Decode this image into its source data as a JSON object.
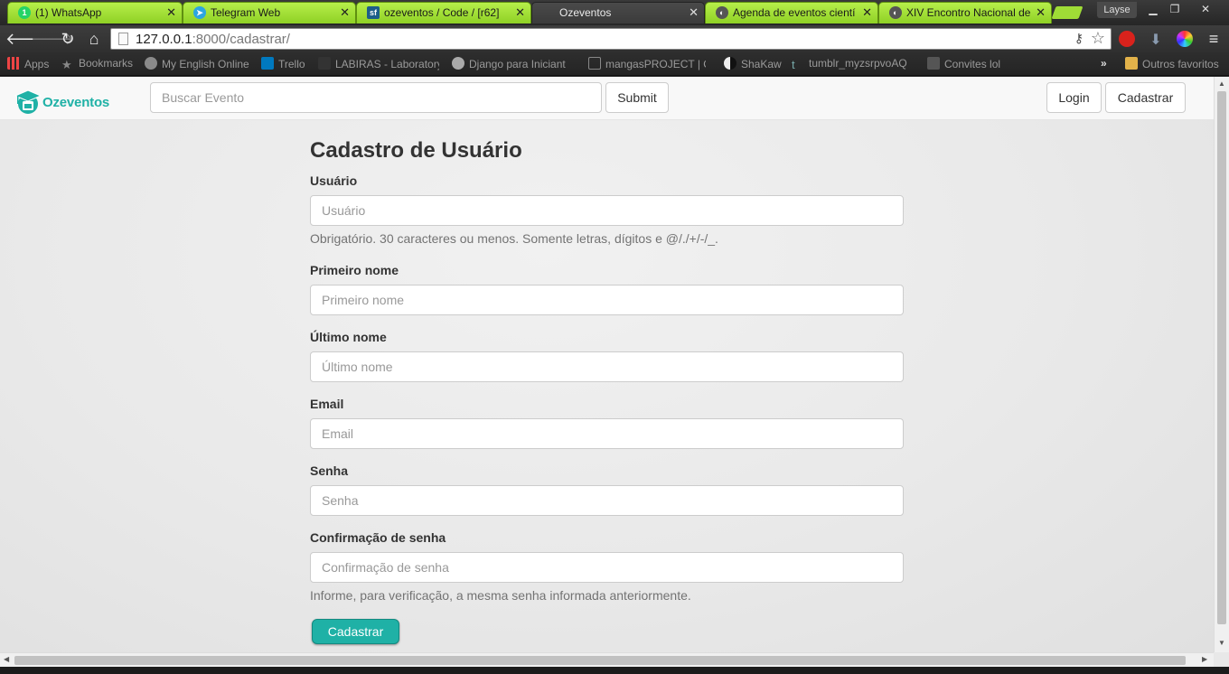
{
  "browser": {
    "tabs": [
      {
        "title": "(1) WhatsApp",
        "icon": "whatsapp-icon",
        "color": "#25d366"
      },
      {
        "title": "Telegram Web",
        "icon": "telegram-icon",
        "color": "#2ca5e0"
      },
      {
        "title": "ozeventos / Code / [r62]",
        "icon": "sourceforge-icon",
        "color": "#1c5e8a"
      },
      {
        "title": "Ozeventos",
        "icon": "page-icon",
        "color": "#555555"
      },
      {
        "title": "Agenda de eventos cientí",
        "icon": "event-icon",
        "color": "#555555"
      },
      {
        "title": "XIV Encontro Nacional de",
        "icon": "event-icon",
        "color": "#555555"
      }
    ],
    "profile_name": "Layse",
    "url_host": "127.0.0.1",
    "url_path": ":8000/cadastrar/",
    "bookmarks": [
      {
        "label": "Apps",
        "icon": "apps-grid-icon"
      },
      {
        "label": "Bookmarks",
        "icon": "star-icon"
      },
      {
        "label": "My English Online",
        "icon": "globe-icon"
      },
      {
        "label": "Trello",
        "icon": "trello-icon"
      },
      {
        "label": "LABIRAS - Laboratory",
        "icon": "lab-icon"
      },
      {
        "label": "Django para Iniciant",
        "icon": "wordpress-icon"
      },
      {
        "label": "mangasPROJECT | O",
        "icon": "page-icon"
      },
      {
        "label": "ShaKaw",
        "icon": "yinyang-icon"
      },
      {
        "label": "tumblr_myzsrpvoAQ",
        "icon": "tumblr-icon"
      },
      {
        "label": "Convites lol",
        "icon": "image-icon"
      }
    ],
    "overflow_label": "»",
    "other_bookmarks": "Outros favoritos"
  },
  "site": {
    "brand": "Ozeventos",
    "search_placeholder": "Buscar Evento",
    "search_button": "Submit",
    "login_button": "Login",
    "signup_button": "Cadastrar"
  },
  "form": {
    "title": "Cadastro de Usuário",
    "fields": [
      {
        "label": "Usuário",
        "placeholder": "Usuário",
        "help": "Obrigatório. 30 caracteres ou menos. Somente letras, dígitos e @/./+/-/_."
      },
      {
        "label": "Primeiro nome",
        "placeholder": "Primeiro nome"
      },
      {
        "label": "Último nome",
        "placeholder": "Último nome"
      },
      {
        "label": "Email",
        "placeholder": "Email"
      },
      {
        "label": "Senha",
        "placeholder": "Senha"
      },
      {
        "label": "Confirmação de senha",
        "placeholder": "Confirmação de senha",
        "help": "Informe, para verificação, a mesma senha informada anteriormente."
      }
    ],
    "submit": "Cadastrar"
  },
  "colors": {
    "accent": "#1fb1a6",
    "tab_green": "#9fdc36"
  }
}
